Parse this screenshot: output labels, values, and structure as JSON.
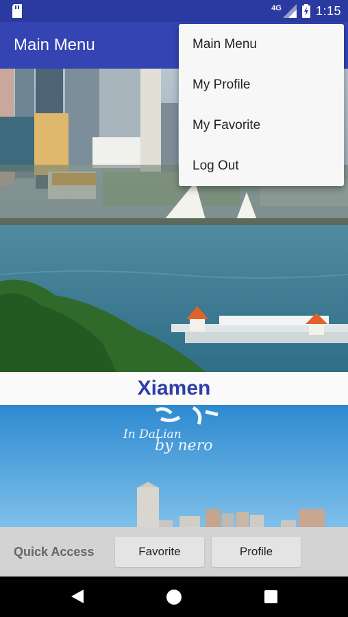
{
  "status_bar": {
    "network": "4G",
    "time": "1:15",
    "icons": [
      "sd-card-icon",
      "signal-icon",
      "battery-charging-icon"
    ]
  },
  "app_bar": {
    "title": "Main Menu"
  },
  "overflow_menu": {
    "items": [
      {
        "label": "Main Menu"
      },
      {
        "label": "My Profile"
      },
      {
        "label": "My Favorite"
      },
      {
        "label": "Log Out"
      }
    ]
  },
  "gallery": {
    "caption": "Xiamen",
    "photo2_text": [
      "In DaLian",
      "by nero"
    ]
  },
  "quick_access": {
    "label": "Quick Access",
    "favorite_label": "Favorite",
    "profile_label": "Profile"
  },
  "nav_bar": {
    "icons": [
      "back-icon",
      "home-icon",
      "recents-icon"
    ]
  },
  "colors": {
    "status_bar": "#2a3aa0",
    "app_bar": "#3444b3",
    "caption_text": "#2f3fa8",
    "quick_bar": "#d3d3d3"
  }
}
